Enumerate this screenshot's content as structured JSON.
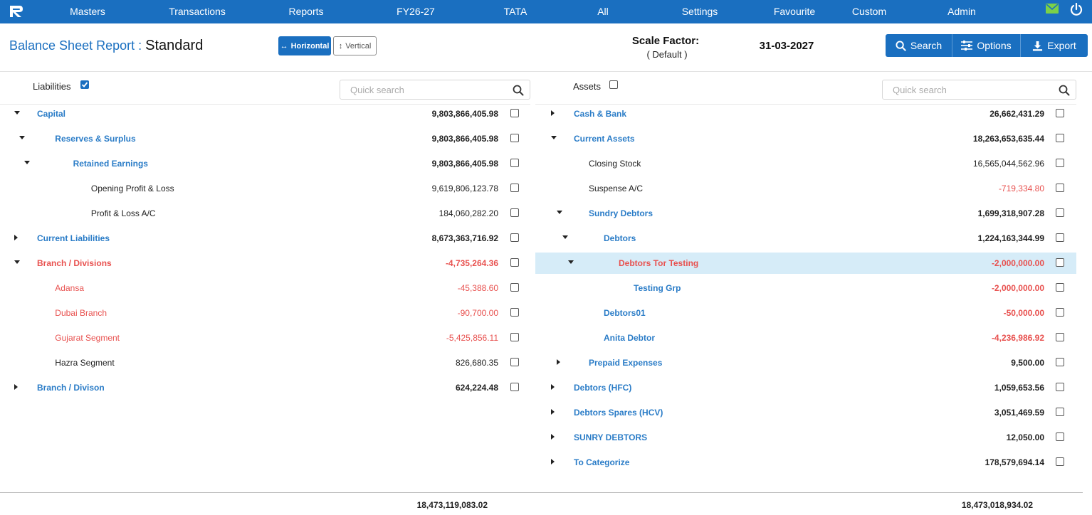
{
  "nav": {
    "items": [
      "Masters",
      "Transactions",
      "Reports",
      "FY26-27",
      "TATA",
      "All",
      "Settings",
      "Favourite",
      "Custom",
      "Admin"
    ]
  },
  "header": {
    "title_label": "Balance Sheet Report :",
    "title_value": "Standard",
    "horizontal_label": "Horizontal",
    "vertical_label": "Vertical",
    "scale_label": "Scale Factor:",
    "scale_value": "( Default )",
    "date": "31-03-2027",
    "search_label": "Search",
    "options_label": "Options",
    "export_label": "Export"
  },
  "liabilities": {
    "label": "Liabilities",
    "checked": true,
    "search_placeholder": "Quick search",
    "rows": [
      {
        "name": "Capital",
        "amount": "9,803,866,405.98",
        "level": 0,
        "caret": "down",
        "style": "blue",
        "amount_style": "black-bold"
      },
      {
        "name": "Reserves & Surplus",
        "amount": "9,803,866,405.98",
        "level": 1,
        "caret": "down",
        "style": "blue",
        "amount_style": "black-bold"
      },
      {
        "name": "Retained Earnings",
        "amount": "9,803,866,405.98",
        "level": 2,
        "caret": "down",
        "style": "blue",
        "amount_style": "black-bold"
      },
      {
        "name": "Opening Profit & Loss",
        "amount": "9,619,806,123.78",
        "level": 3,
        "caret": "",
        "style": "black",
        "amount_style": "black"
      },
      {
        "name": "Profit & Loss A/C",
        "amount": "184,060,282.20",
        "level": 3,
        "caret": "",
        "style": "black",
        "amount_style": "black"
      },
      {
        "name": "Current Liabilities",
        "amount": "8,673,363,716.92",
        "level": 0,
        "caret": "right",
        "style": "blue",
        "amount_style": "black-bold"
      },
      {
        "name": "Branch / Divisions",
        "amount": "-4,735,264.36",
        "level": 0,
        "caret": "down",
        "style": "red",
        "amount_style": "red"
      },
      {
        "name": "Adansa",
        "amount": "-45,388.60",
        "level": 1,
        "caret": "",
        "style": "red-plain",
        "amount_style": "red-plain"
      },
      {
        "name": "Dubai Branch",
        "amount": "-90,700.00",
        "level": 1,
        "caret": "",
        "style": "red-plain",
        "amount_style": "red-plain"
      },
      {
        "name": "Gujarat Segment",
        "amount": "-5,425,856.11",
        "level": 1,
        "caret": "",
        "style": "red-plain",
        "amount_style": "red-plain"
      },
      {
        "name": "Hazra Segment",
        "amount": "826,680.35",
        "level": 1,
        "caret": "",
        "style": "black",
        "amount_style": "black"
      },
      {
        "name": "Branch / Divison",
        "amount": "624,224.48",
        "level": 0,
        "caret": "right",
        "style": "blue",
        "amount_style": "black-bold"
      }
    ],
    "total": "18,473,119,083.02"
  },
  "assets": {
    "label": "Assets",
    "checked": false,
    "search_placeholder": "Quick search",
    "rows": [
      {
        "name": "Cash & Bank",
        "amount": "26,662,431.29",
        "level": 0,
        "caret": "right",
        "style": "blue",
        "amount_style": "black-bold"
      },
      {
        "name": "Current Assets",
        "amount": "18,263,653,635.44",
        "level": 0,
        "caret": "down",
        "style": "blue",
        "amount_style": "black-bold"
      },
      {
        "name": "Closing Stock",
        "amount": "16,565,044,562.96",
        "level": 1,
        "caret": "",
        "style": "black",
        "amount_style": "black"
      },
      {
        "name": "Suspense A/C",
        "amount": "-719,334.80",
        "level": 1,
        "caret": "",
        "style": "black",
        "amount_style": "red-plain"
      },
      {
        "name": "Sundry Debtors",
        "amount": "1,699,318,907.28",
        "level": 1,
        "caret": "down",
        "style": "blue",
        "amount_style": "black-bold"
      },
      {
        "name": "Debtors",
        "amount": "1,224,163,344.99",
        "level": 2,
        "caret": "down",
        "style": "blue",
        "amount_style": "black-bold"
      },
      {
        "name": "Debtors Tor Testing",
        "amount": "-2,000,000.00",
        "level": 3,
        "caret": "down",
        "style": "red",
        "amount_style": "red",
        "highlight": true
      },
      {
        "name": "Testing Grp",
        "amount": "-2,000,000.00",
        "level": 4,
        "caret": "",
        "style": "blue",
        "amount_style": "red"
      },
      {
        "name": "Debtors01",
        "amount": "-50,000.00",
        "level": 2,
        "caret": "",
        "style": "blue",
        "amount_style": "red"
      },
      {
        "name": "Anita Debtor",
        "amount": "-4,236,986.92",
        "level": 2,
        "caret": "",
        "style": "blue",
        "amount_style": "red"
      },
      {
        "name": "Prepaid Expenses",
        "amount": "9,500.00",
        "level": 1,
        "caret": "right",
        "style": "blue",
        "amount_style": "black-bold"
      },
      {
        "name": "Debtors (HFC)",
        "amount": "1,059,653.56",
        "level": 0,
        "caret": "right",
        "style": "blue",
        "amount_style": "black-bold"
      },
      {
        "name": "Debtors Spares (HCV)",
        "amount": "3,051,469.59",
        "level": 0,
        "caret": "right",
        "style": "blue",
        "amount_style": "black-bold"
      },
      {
        "name": "SUNRY DEBTORS",
        "amount": "12,050.00",
        "level": 0,
        "caret": "right",
        "style": "blue",
        "amount_style": "black-bold"
      },
      {
        "name": "To Categorize",
        "amount": "178,579,694.14",
        "level": 0,
        "caret": "right",
        "style": "blue",
        "amount_style": "black-bold"
      }
    ],
    "total": "18,473,018,934.02"
  },
  "icons": {
    "logo": "app-logo-icon",
    "mail": "mail-icon",
    "power": "power-icon",
    "search": "search-icon",
    "options": "sliders-icon",
    "export": "download-icon"
  },
  "colors": {
    "nav_bg": "#1a6fc0",
    "link_blue": "#2a7cc7",
    "negative_red": "#e8514f",
    "highlight_row": "#d6ecf8"
  }
}
